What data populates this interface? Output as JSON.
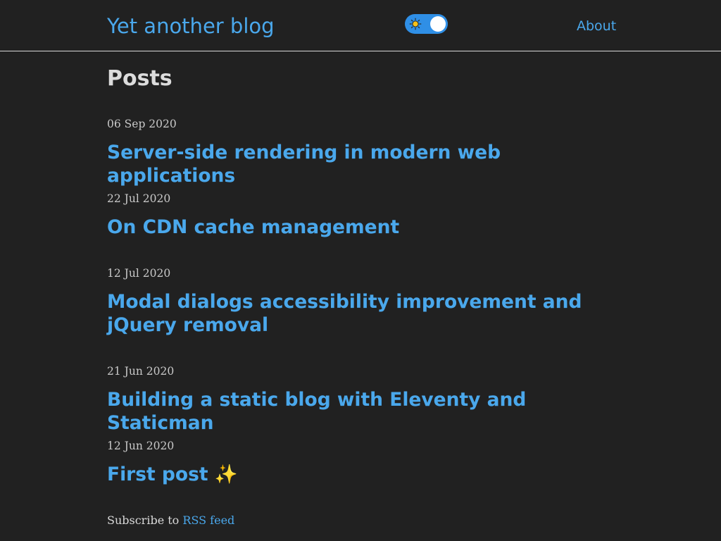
{
  "header": {
    "site_title": "Yet another blog",
    "theme_toggle": {
      "state": "dark",
      "icon": "sun-icon"
    },
    "nav": [
      {
        "label": "About"
      }
    ]
  },
  "main": {
    "heading": "Posts",
    "posts": [
      {
        "date": "06 Sep 2020",
        "title": "Server-side rendering in modern web applications"
      },
      {
        "date": "22 Jul 2020",
        "title": "On CDN cache management"
      },
      {
        "date": "12 Jul 2020",
        "title": "Modal dialogs accessibility improvement and jQuery removal"
      },
      {
        "date": "21 Jun 2020",
        "title": "Building a static blog with Eleventy and Staticman"
      },
      {
        "date": "12 Jun 2020",
        "title": "First post ✨"
      }
    ]
  },
  "footer": {
    "subscribe_prefix": "Subscribe to",
    "rss_link": "RSS feed"
  },
  "colors": {
    "background": "#212121",
    "accent": "#4aa8ec",
    "toggle": "#2f8fe6"
  }
}
